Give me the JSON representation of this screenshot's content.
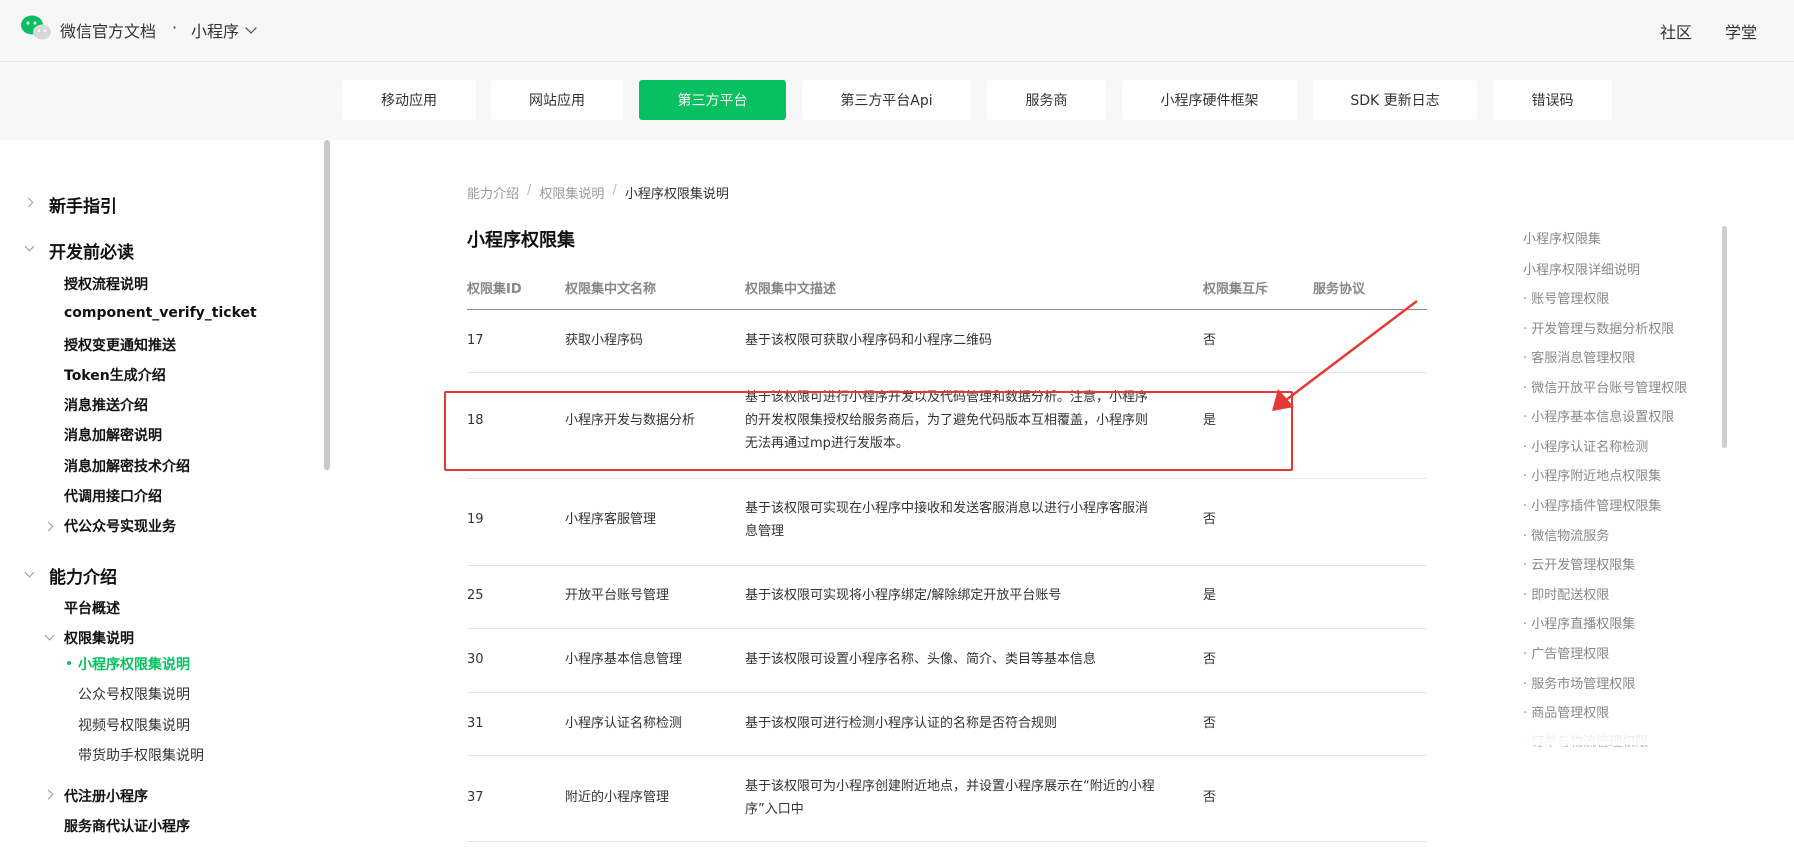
{
  "header": {
    "brand": "微信官方文档",
    "dot": "·",
    "product": "小程序",
    "links": [
      "社区",
      "学堂"
    ]
  },
  "nav": {
    "items": [
      "移动应用",
      "网站应用",
      "第三方平台",
      "第三方平台Api",
      "服务商",
      "小程序硬件框架",
      "SDK 更新日志",
      "错误码"
    ],
    "active_index": 2,
    "active_color": "#07c160"
  },
  "sidebar": {
    "items": [
      {
        "label": "新手指引"
      },
      {
        "label": "开发前必读"
      },
      {
        "label": "授权流程说明"
      },
      {
        "label": "component_verify_ticket"
      },
      {
        "label": "授权变更通知推送"
      },
      {
        "label": "Token生成介绍"
      },
      {
        "label": "消息推送介绍"
      },
      {
        "label": "消息加解密说明"
      },
      {
        "label": "消息加解密技术介绍"
      },
      {
        "label": "代调用接口介绍"
      },
      {
        "label": "代公众号实现业务"
      },
      {
        "label": "能力介绍"
      },
      {
        "label": "平台概述"
      },
      {
        "label": "权限集说明"
      },
      {
        "label": "小程序权限集说明"
      },
      {
        "label": "公众号权限集说明"
      },
      {
        "label": "视频号权限集说明"
      },
      {
        "label": "带货助手权限集说明"
      },
      {
        "label": "代注册小程序"
      },
      {
        "label": "服务商代认证小程序"
      }
    ]
  },
  "breadcrumb": {
    "items": [
      "能力介绍",
      "权限集说明",
      "小程序权限集说明"
    ],
    "separator": "/"
  },
  "page": {
    "title": "小程序权限集"
  },
  "table": {
    "headers": [
      "权限集ID",
      "权限集中文名称",
      "权限集中文描述",
      "权限集互斥",
      "服务协议"
    ],
    "rows": [
      {
        "id": "17",
        "name": "获取小程序码",
        "desc": "基于该权限可获取小程序码和小程序二维码",
        "mutex": "否"
      },
      {
        "id": "18",
        "name": "小程序开发与数据分析",
        "desc": "基于该权限可进行小程序开发以及代码管理和数据分析。注意，小程序的开发权限集授权给服务商后，为了避免代码版本互相覆盖，小程序则无法再通过mp进行发版本。",
        "mutex": "是"
      },
      {
        "id": "19",
        "name": "小程序客服管理",
        "desc": "基于该权限可实现在小程序中接收和发送客服消息以进行小程序客服消息管理",
        "mutex": "否"
      },
      {
        "id": "25",
        "name": "开放平台账号管理",
        "desc": "基于该权限可实现将小程序绑定/解除绑定开放平台账号",
        "mutex": "是"
      },
      {
        "id": "30",
        "name": "小程序基本信息管理",
        "desc": "基于该权限可设置小程序名称、头像、简介、类目等基本信息",
        "mutex": "否"
      },
      {
        "id": "31",
        "name": "小程序认证名称检测",
        "desc": "基于该权限可进行检测小程序认证的名称是否符合规则",
        "mutex": "否"
      },
      {
        "id": "37",
        "name": "附近的小程序管理",
        "desc": "基于该权限可为小程序创建附近地点，并设置小程序展示在“附近的小程序”入口中",
        "mutex": "否"
      }
    ]
  },
  "toc": {
    "items": [
      "小程序权限集",
      "小程序权限详细说明",
      "· 账号管理权限",
      "· 开发管理与数据分析权限",
      "· 客服消息管理权限",
      "· 微信开放平台账号管理权限",
      "· 小程序基本信息设置权限",
      "· 小程序认证名称检测",
      "· 小程序附近地点权限集",
      "· 小程序插件管理权限集",
      "· 微信物流服务",
      "· 云开发管理权限集",
      "· 即时配送权限",
      "· 小程序直播权限集",
      "· 广告管理权限",
      "· 服务市场管理权限",
      "· 商品管理权限",
      "· 订单与物流管理权限"
    ]
  },
  "annotation": {
    "color": "#e53935"
  }
}
